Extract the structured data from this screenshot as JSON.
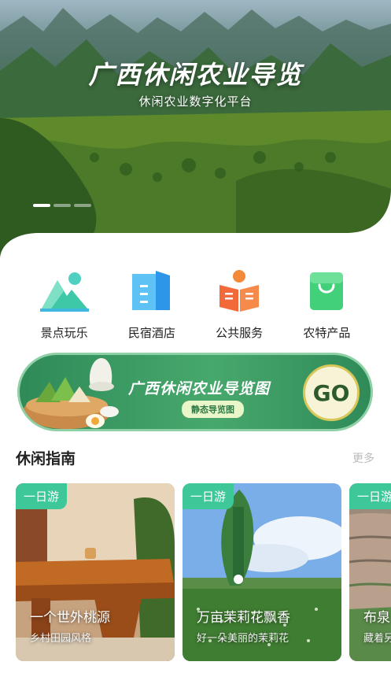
{
  "hero": {
    "title": "广西休闲农业导览",
    "subtitle": "休闲农业数字化平台",
    "carousel_dots": 3,
    "active_dot": 0
  },
  "categories": [
    {
      "label": "景点玩乐",
      "icon": "mountain-icon"
    },
    {
      "label": "民宿酒店",
      "icon": "hotel-building-icon"
    },
    {
      "label": "公共服务",
      "icon": "public-service-book-icon"
    },
    {
      "label": "农特产品",
      "icon": "shopping-bag-icon"
    }
  ],
  "banner": {
    "title": "广西休闲农业导览图",
    "pill": "静态导览图",
    "go_label": "GO"
  },
  "section": {
    "title": "休闲指南",
    "more": "更多"
  },
  "guides": [
    {
      "badge": "一日游",
      "title": "一个世外桃源",
      "subtitle": "乡村田园风格"
    },
    {
      "badge": "一日游",
      "title": "万亩茉莉花飘香",
      "subtitle": "好一朵美丽的茉莉花"
    },
    {
      "badge": "一日游",
      "title": "布泉",
      "subtitle": "藏着另"
    }
  ],
  "colors": {
    "accent_green": "#3ec89a",
    "banner_green": "#47a86c"
  }
}
